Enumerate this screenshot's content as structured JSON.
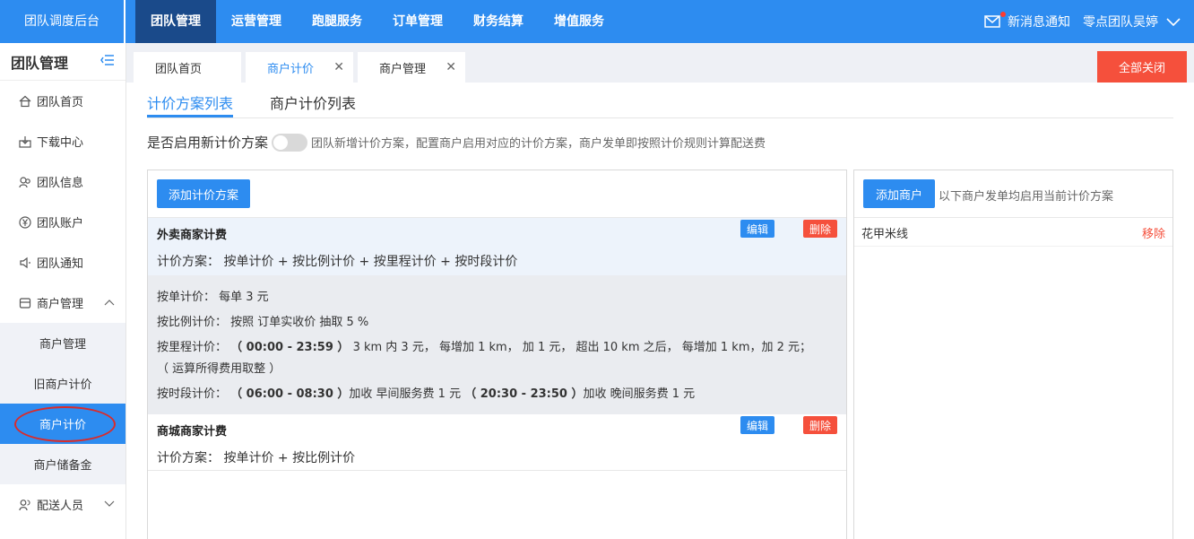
{
  "header": {
    "brand": "团队调度后台",
    "nav": [
      "团队管理",
      "运营管理",
      "跑腿服务",
      "订单管理",
      "财务结算",
      "增值服务"
    ],
    "notice": "新消息通知",
    "user": "零点团队吴婷"
  },
  "sidebar": {
    "title": "团队管理",
    "items": [
      {
        "label": "团队首页",
        "icon": "home-icon"
      },
      {
        "label": "下载中心",
        "icon": "download-icon"
      },
      {
        "label": "团队信息",
        "icon": "team-icon"
      },
      {
        "label": "团队账户",
        "icon": "yen-icon"
      },
      {
        "label": "团队通知",
        "icon": "speaker-icon"
      },
      {
        "label": "商户管理",
        "icon": "store-icon"
      }
    ],
    "subitems": [
      "商户管理",
      "旧商户计价",
      "商户计价",
      "商户储备金"
    ],
    "last_item": {
      "label": "配送人员",
      "icon": "users-icon"
    }
  },
  "tabs": {
    "items": [
      "团队首页",
      "商户计价",
      "商户管理"
    ],
    "close_all": "全部关闭"
  },
  "subtabs": [
    "计价方案列表",
    "商户计价列表"
  ],
  "toggle": {
    "label": "是否启用新计价方案",
    "desc": "团队新增计价方案，配置商户启用对应的计价方案，商户发单即按照计价规则计算配送费"
  },
  "left_panel": {
    "add_button": "添加计价方案",
    "edit_label": "编辑",
    "delete_label": "删除",
    "plans": [
      {
        "title": "外卖商家计费",
        "summary": "计价方案： 按单计价 + 按比例计价 + 按里程计价 + 按时段计价"
      },
      {
        "title": "商城商家计费",
        "summary": "计价方案： 按单计价 + 按比例计价"
      }
    ],
    "details": {
      "per_order": "按单计价： 每单 3 元",
      "ratio": "按比例计价： 按照 订单实收价 抽取 5 %",
      "mileage_prefix": "按里程计价：",
      "mileage_time": "（ 00:00 - 23:59 ）",
      "mileage_rule": "3 km 内 3 元， 每增加 1 km， 加 1 元， 超出 10 km 之后， 每增加 1 km，加 2 元；",
      "mileage_note": "（ 运算所得费用取整 ）",
      "period_prefix": "按时段计价：",
      "period_time1": "（ 06:00 - 08:30 ）",
      "period_rule1": "加收 早间服务费 1 元",
      "period_time2": "（ 20:30 - 23:50 ）",
      "period_rule2": "加收 晚间服务费 1 元"
    }
  },
  "right_panel": {
    "add_button": "添加商户",
    "note": "以下商户发单均启用当前计价方案",
    "merchants": [
      {
        "name": "花甲米线",
        "action": "移除"
      }
    ]
  }
}
